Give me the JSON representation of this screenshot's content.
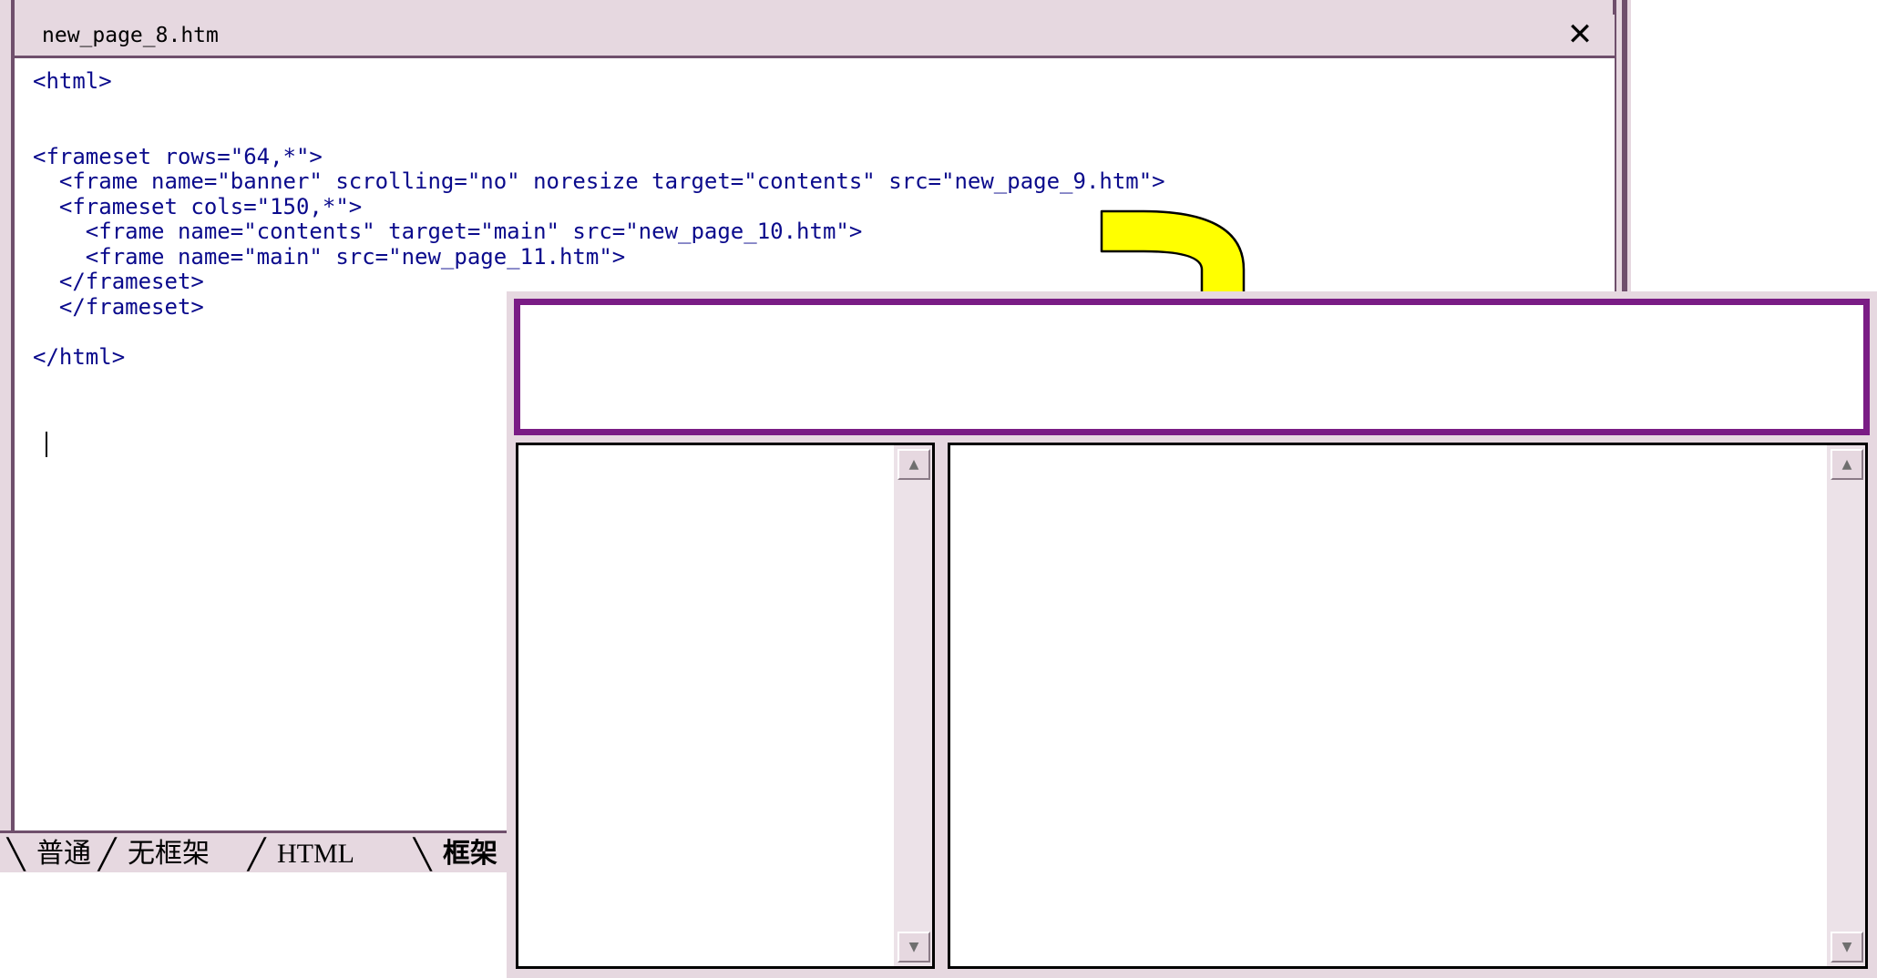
{
  "editor": {
    "title": "new_page_8.htm",
    "close_glyph": "✕",
    "code_lines": [
      "<html>",
      "",
      "",
      "<frameset rows=\"64,*\">",
      "  <frame name=\"banner\" scrolling=\"no\" noresize target=\"contents\" src=\"new_page_9.htm\">",
      "  <frameset cols=\"150,*\">",
      "    <frame name=\"contents\" target=\"main\" src=\"new_page_10.htm\">",
      "    <frame name=\"main\" src=\"new_page_11.htm\">",
      "  </frameset>",
      "  </frameset>",
      "",
      "</html>"
    ]
  },
  "tabs": [
    {
      "label": "普通",
      "active": false
    },
    {
      "label": "无框架",
      "active": false
    },
    {
      "label": "HTML",
      "active": false
    },
    {
      "label": "框架",
      "active": true
    }
  ],
  "preview": {
    "scroll_up_glyph": "▲",
    "scroll_down_glyph": "▼"
  },
  "colors": {
    "chrome": "#e6d8e0",
    "border": "#6f4f6c",
    "code_tag": "#0a0a8c",
    "banner_border": "#7a1c85",
    "arrow_fill": "#ffff00"
  },
  "icons": [
    "close-icon",
    "curved-arrow-icon",
    "scroll-up-icon",
    "scroll-down-icon"
  ]
}
